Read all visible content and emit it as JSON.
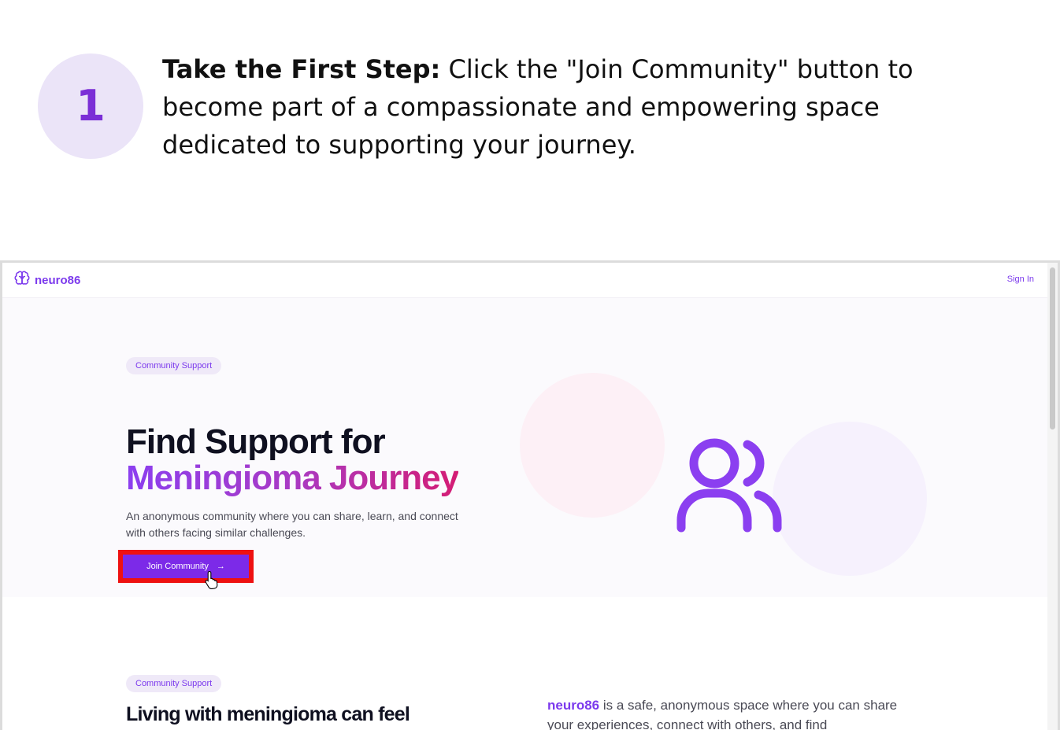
{
  "step": {
    "number": "1",
    "title": "Take the First Step:",
    "text": " Click the \"Join Community\" button to become part of a compassionate and empowering space dedicated to supporting your journey."
  },
  "site": {
    "logo_text": "neuro86",
    "signin_label": "Sign In",
    "hero": {
      "badge": "Community Support",
      "heading_line1": "Find Support for",
      "heading_line2": "Meningioma Journey",
      "lead": "An anonymous community where you can share, learn, and connect with others facing similar challenges.",
      "cta_label": "Join Community",
      "cta_arrow": "→"
    },
    "section2": {
      "badge": "Community Support",
      "title": "Living with meningioma can feel",
      "brand": "neuro86",
      "text": " is a safe, anonymous space where you can share your experiences, connect with others, and find"
    }
  },
  "colors": {
    "accent": "#7c3aed",
    "button": "#7c2ae8",
    "highlight": "#ee1111",
    "step_circle": "#ebe4f8",
    "step_number": "#7b2fd6"
  },
  "icons": [
    "brain-icon",
    "users-icon",
    "arrow-right-icon",
    "hand-cursor-icon"
  ]
}
